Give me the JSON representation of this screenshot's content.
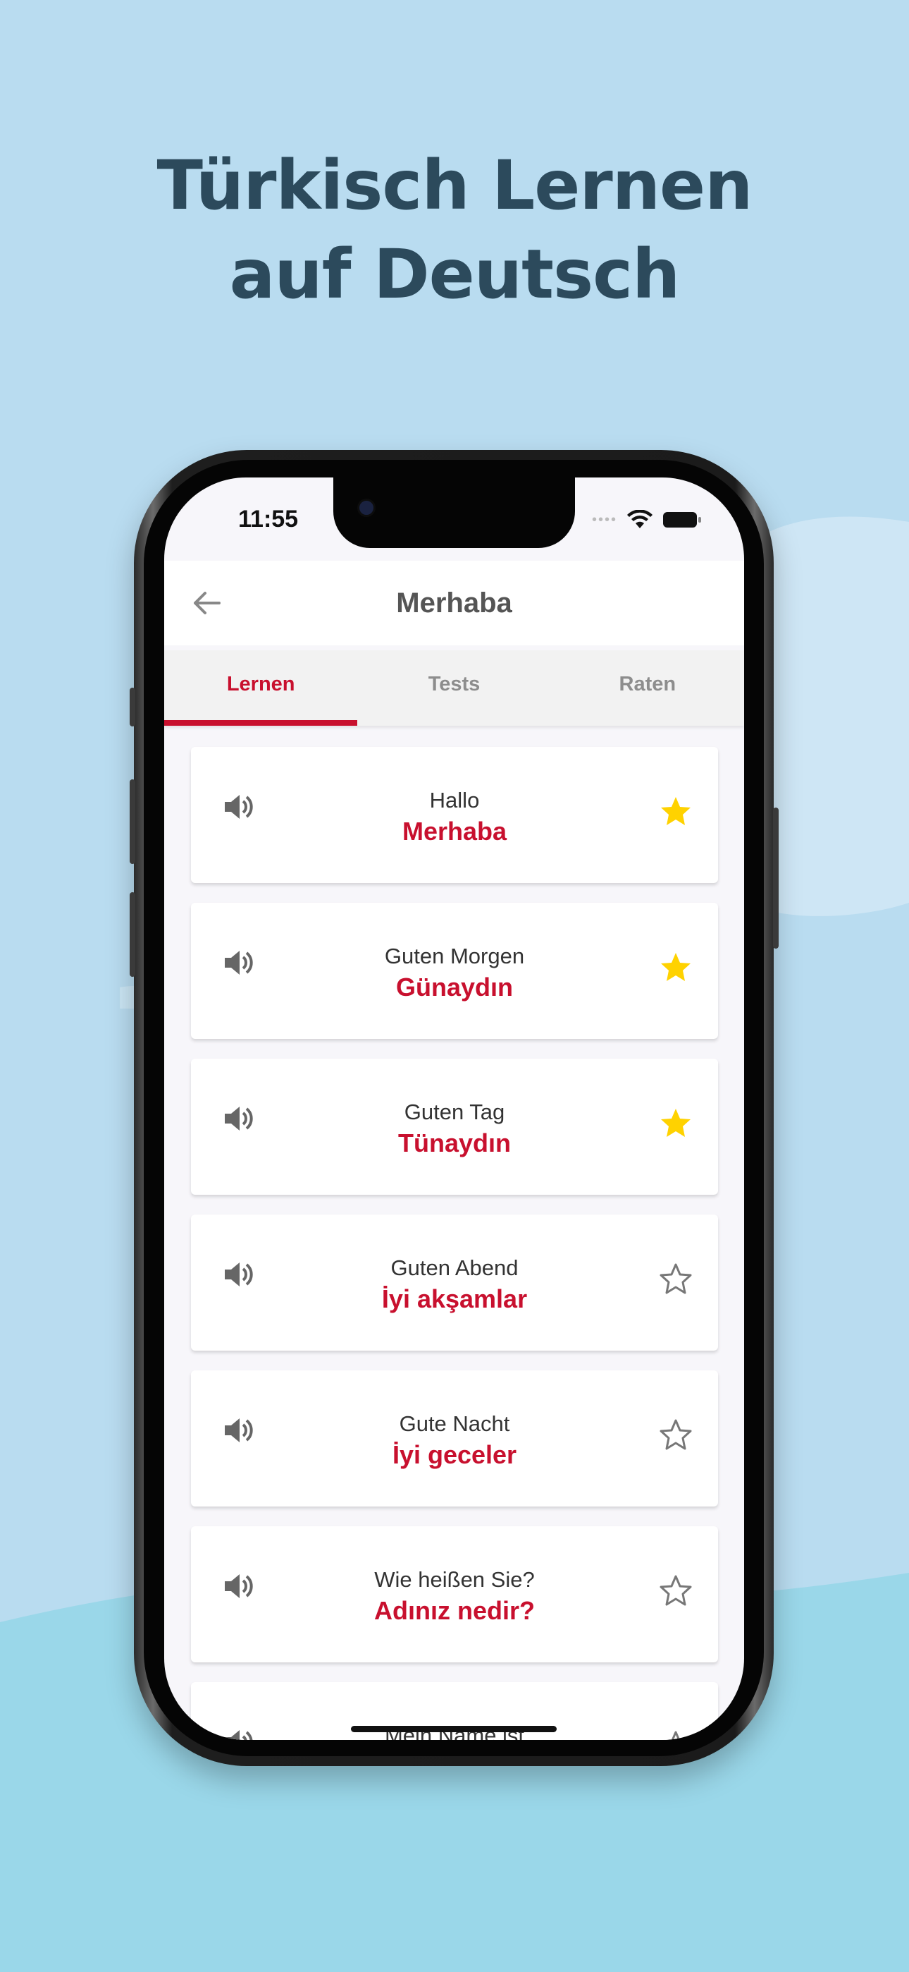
{
  "headline": {
    "line1": "Türkisch Lernen",
    "line2": "auf Deutsch"
  },
  "status_bar": {
    "time": "11:55"
  },
  "app_bar": {
    "back_icon": "arrow-left-icon",
    "title": "Merhaba"
  },
  "tabs": [
    {
      "label": "Lernen",
      "active": true
    },
    {
      "label": "Tests",
      "active": false
    },
    {
      "label": "Raten",
      "active": false
    }
  ],
  "phrases": [
    {
      "de": "Hallo",
      "tr": "Merhaba",
      "favorite": true
    },
    {
      "de": "Guten Morgen",
      "tr": "Günaydın",
      "favorite": true
    },
    {
      "de": "Guten Tag",
      "tr": "Tünaydın",
      "favorite": true
    },
    {
      "de": "Guten Abend",
      "tr": "İyi akşamlar",
      "favorite": false
    },
    {
      "de": "Gute Nacht",
      "tr": "İyi geceler",
      "favorite": false
    },
    {
      "de": "Wie heißen Sie?",
      "tr": "Adınız nedir?",
      "favorite": false
    },
    {
      "de": "Mein Name ist",
      "tr": "",
      "favorite": false
    }
  ],
  "colors": {
    "accent": "#c8102e",
    "star_filled": "#ffd200",
    "background": "#b9dcf0",
    "headline": "#2c4a5c"
  }
}
